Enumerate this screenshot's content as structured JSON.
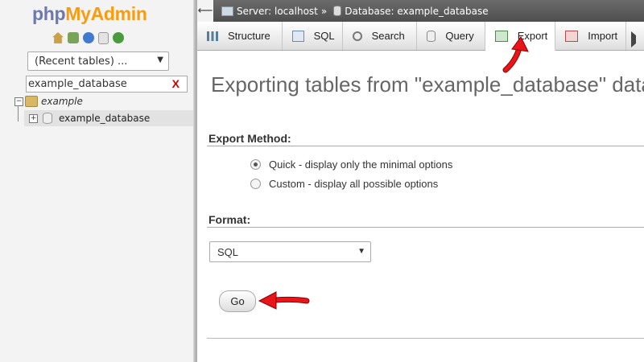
{
  "nav": {
    "logo": {
      "php": "php",
      "myadmin": "MyAdmin"
    },
    "icons": [
      "home-icon",
      "exit-icon",
      "help-icon",
      "docs-icon",
      "reload-icon"
    ],
    "recent_tables": "(Recent tables) ...",
    "filter_value": "example_database",
    "filter_clear": "X",
    "tree": {
      "db_label": "example",
      "table_label": "example_database"
    }
  },
  "breadcrumb": {
    "server": "Server: localhost",
    "separator": "»",
    "database": "Database: example_database"
  },
  "tabs": [
    {
      "label": "Structure",
      "icon": "structure-icon"
    },
    {
      "label": "SQL",
      "icon": "sql-icon"
    },
    {
      "label": "Search",
      "icon": "search-icon"
    },
    {
      "label": "Query",
      "icon": "query-icon"
    },
    {
      "label": "Export",
      "icon": "export-icon",
      "active": true
    },
    {
      "label": "Import",
      "icon": "import-icon"
    }
  ],
  "main": {
    "title": "Exporting tables from \"example_database\" data",
    "export_method": {
      "heading": "Export Method:",
      "options": [
        {
          "label": "Quick - display only the minimal options",
          "checked": true
        },
        {
          "label": "Custom - display all possible options",
          "checked": false
        }
      ]
    },
    "format": {
      "heading": "Format:",
      "selected": "SQL"
    },
    "go_label": "Go"
  },
  "colors": {
    "logo_php": "#6c78af",
    "logo_myadmin": "#f89c0e",
    "annotation_arrow": "#e8161b"
  }
}
